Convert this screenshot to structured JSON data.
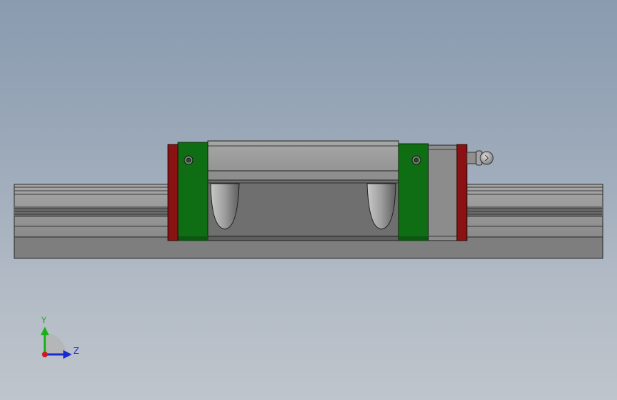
{
  "viewport": {
    "background_top": "#8a9bb0",
    "background_bottom": "#bfc5cc"
  },
  "model": {
    "rail_color": "#8c8c8c",
    "carriage_body_color": "#6f6f6f",
    "end_cap_color": "#0f6e14",
    "end_seal_color": "#8b1212",
    "grease_fitting_color": "#9a9a9a"
  },
  "triad": {
    "y_label": "Y",
    "z_label": "Z",
    "y_color": "#19b019",
    "z_color": "#1a2ad0",
    "x_color": "#c81e1e"
  }
}
